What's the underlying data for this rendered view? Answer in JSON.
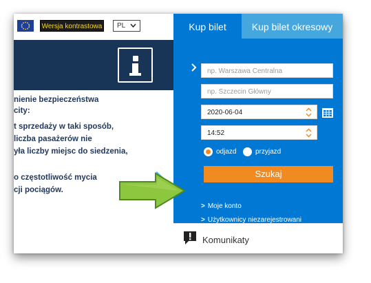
{
  "topbar": {
    "contrast_label": "Wersja kontrastowa",
    "language_value": "PL"
  },
  "article": {
    "lines_bold": [
      "nienie bezpieczeństwa",
      "city:"
    ],
    "lines": [
      "t sprzedaży w taki sposób,",
      "liczba pasażerów nie",
      "yła liczby miejsc do siedzenia,",
      "",
      "o częstotliwość mycia",
      "cji pociągów."
    ]
  },
  "tabs": {
    "buy_ticket": "Kup bilet",
    "season_ticket": "Kup bilet okresowy"
  },
  "form": {
    "from_placeholder": "np. Warszawa Centralna",
    "to_placeholder": "np. Szczecin Główny",
    "date_value": "2020-06-04",
    "time_value": "14:52",
    "radio_departure": "odjazd",
    "radio_arrival": "przyjazd",
    "selected_radio": "odjazd",
    "search_label": "Szukaj",
    "link_account": "Moje konto",
    "link_unregistered": "Użytkownicy niezarejestrowani",
    "link_prefix": ">"
  },
  "announcements": {
    "label": "Komunikaty"
  },
  "colors": {
    "primary_blue": "#0078d4",
    "light_blue_tab": "#45a7de",
    "navy": "#183557",
    "orange": "#f28a22",
    "arrow_green": "#8dc63f",
    "contrast_text": "#f4d62c"
  },
  "icons": {
    "flag": "eu-flag-icon",
    "info": "info-icon",
    "calendar": "calendar-icon",
    "spinner": "up-down-chevron-icon",
    "expand": "chevron-right-icon",
    "announcement": "speech-bubble-exclamation-icon",
    "pointer": "green-arrow-icon"
  }
}
